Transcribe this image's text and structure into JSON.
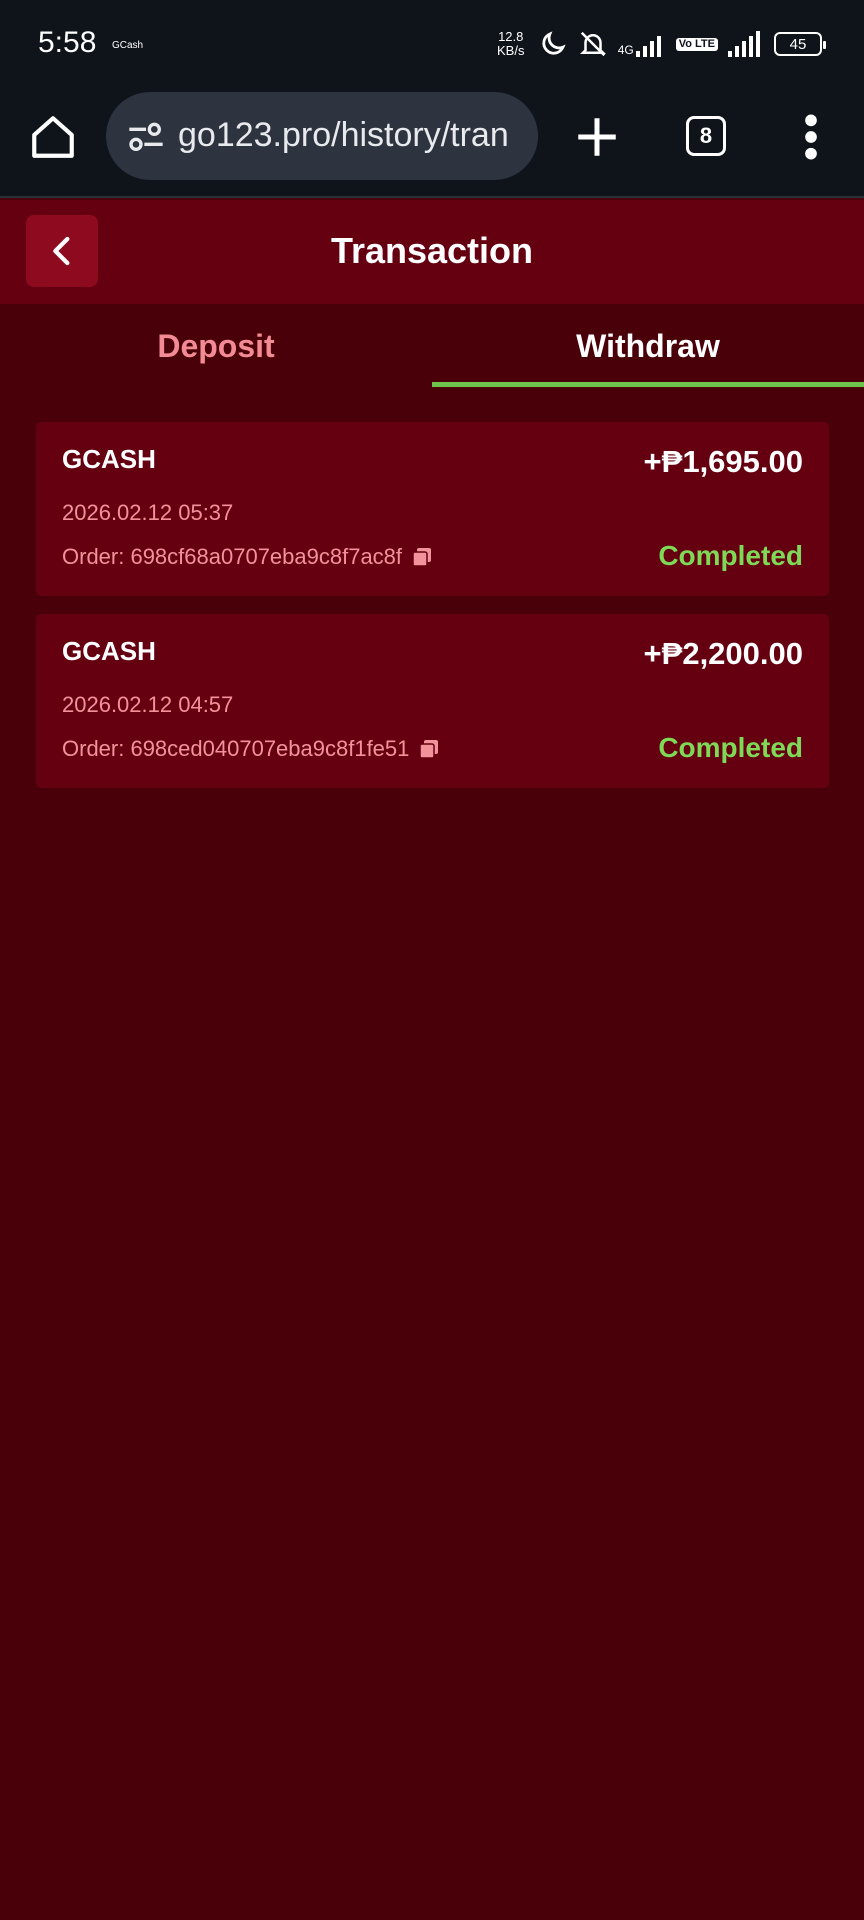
{
  "status_bar": {
    "time": "5:58",
    "app_label": "GCash",
    "net_speed_value": "12.8",
    "net_speed_unit": "KB/s",
    "signal_label": "4G",
    "volte_label": "Vo LTE",
    "battery": "45"
  },
  "browser": {
    "url": "go123.pro/history/tran",
    "tab_count": "8"
  },
  "header": {
    "title": "Transaction"
  },
  "tabs": [
    {
      "label": "Deposit",
      "active": false
    },
    {
      "label": "Withdraw",
      "active": true
    }
  ],
  "transactions": [
    {
      "method": "GCASH",
      "amount": "+₱1,695.00",
      "date": "2026.02.12 05:37",
      "order": "Order: 698cf68a0707eba9c8f7ac8f",
      "status": "Completed"
    },
    {
      "method": "GCASH",
      "amount": "+₱2,200.00",
      "date": "2026.02.12 04:57",
      "order": "Order: 698ced040707eba9c8f1fe51",
      "status": "Completed"
    }
  ],
  "colors": {
    "background": "#4a0008",
    "card": "#650010",
    "accent_green": "#7ed957",
    "tab_indicator": "#6cc24a",
    "muted_pink": "#f2929a"
  }
}
